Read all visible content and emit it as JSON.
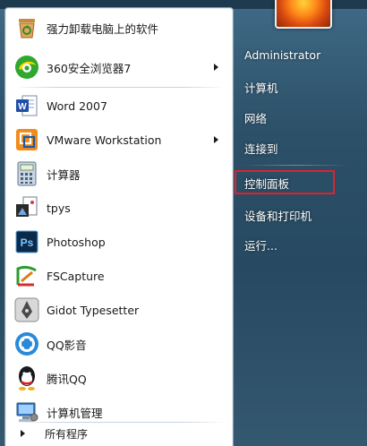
{
  "pinned": [
    {
      "label": "强力卸载电脑上的软件",
      "icon": "uninstall-icon",
      "submenu": false
    },
    {
      "label": "360安全浏览器7",
      "icon": "360-browser-icon",
      "submenu": true
    }
  ],
  "recent": [
    {
      "label": "Word 2007",
      "icon": "word-icon",
      "submenu": false
    },
    {
      "label": "VMware Workstation",
      "icon": "vmware-icon",
      "submenu": true
    },
    {
      "label": "计算器",
      "icon": "calculator-icon",
      "submenu": false
    },
    {
      "label": "tpys",
      "icon": "tpys-icon",
      "submenu": false
    },
    {
      "label": "Photoshop",
      "icon": "photoshop-icon",
      "submenu": false
    },
    {
      "label": "FSCapture",
      "icon": "fscapture-icon",
      "submenu": false
    },
    {
      "label": "Gidot Typesetter",
      "icon": "gidot-icon",
      "submenu": false
    },
    {
      "label": "QQ影音",
      "icon": "qq-player-icon",
      "submenu": false
    },
    {
      "label": "腾讯QQ",
      "icon": "qq-icon",
      "submenu": false
    },
    {
      "label": "计算机管理",
      "icon": "computer-management-icon",
      "submenu": false
    }
  ],
  "all_programs": "所有程序",
  "right_links": [
    {
      "label": "Administrator"
    },
    {
      "label": "计算机"
    },
    {
      "label": "网络"
    },
    {
      "label": "连接到"
    },
    {
      "label": "控制面板",
      "highlighted": true
    },
    {
      "label": "设备和打印机"
    },
    {
      "label": "运行..."
    }
  ],
  "colors": {
    "highlight_border": "#e0202a",
    "right_pane_bg": "#2c5068"
  }
}
